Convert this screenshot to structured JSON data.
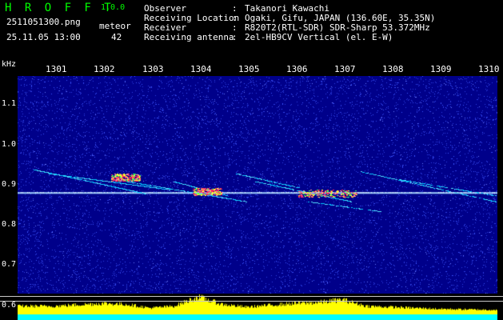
{
  "app": {
    "title": "H R O F F T",
    "version": "1.0.0"
  },
  "capture": {
    "filename": "2511051300.png",
    "datetime": "25.11.05 13:00",
    "meteor_label": "meteor",
    "meteor_count": "42"
  },
  "info": [
    {
      "label": "Observer",
      "sep": ":",
      "value": "Takanori Kawachi"
    },
    {
      "label": "Receiving Location",
      "sep": ":",
      "value": "Ogaki, Gifu, JAPAN (136.60E, 35.35N)"
    },
    {
      "label": "Receiver",
      "sep": ":",
      "value": "R820T2(RTL-SDR) SDR-Sharp 53.372MHz"
    },
    {
      "label": "Receiving antenna",
      "sep": ":",
      "value": "2el-HB9CV Vertical (el. E-W)"
    }
  ],
  "axes": {
    "y_unit": "kHz",
    "time_ticks": [
      "1301",
      "1302",
      "1303",
      "1304",
      "1305",
      "1306",
      "1307",
      "1308",
      "1309",
      "1310"
    ],
    "freq_ticks": [
      "1.1",
      "1.0",
      "0.9",
      "0.8",
      "0.7",
      "0.6"
    ]
  },
  "chart_data": {
    "type": "heatmap",
    "title": "",
    "xlabel": "",
    "ylabel": "kHz",
    "x_ticks": [
      "1301",
      "1302",
      "1303",
      "1304",
      "1305",
      "1306",
      "1307",
      "1308",
      "1309",
      "1310"
    ],
    "y_ticks": [
      1.1,
      1.0,
      0.9,
      0.8,
      0.7,
      0.6
    ],
    "ylim": [
      0.575,
      1.2
    ],
    "carrier_khz": 0.907,
    "colors": {
      "background": "#00008a",
      "noise": "#2f3fe0",
      "carrier": "#9fd0ff",
      "echo": "#00c8ff",
      "strong_echo": "#ff2060",
      "lower_signal": "#ffff00",
      "lower_base": "#00ffff"
    },
    "echoes_comment_free": true,
    "echoes": [
      {
        "t0": 1300.6,
        "f0": 0.965,
        "t1": 1302.9,
        "f1": 0.905,
        "intensity": 0.8
      },
      {
        "t0": 1300.9,
        "f0": 0.955,
        "t1": 1303.4,
        "f1": 0.915,
        "intensity": 0.7
      },
      {
        "t0": 1302.3,
        "f0": 0.94,
        "t1": 1305.0,
        "f1": 0.885,
        "intensity": 0.6
      },
      {
        "t0": 1304.8,
        "f0": 0.955,
        "t1": 1306.1,
        "f1": 0.92,
        "intensity": 0.6
      },
      {
        "t0": 1305.2,
        "f0": 0.935,
        "t1": 1307.2,
        "f1": 0.885,
        "intensity": 0.55
      },
      {
        "t0": 1307.4,
        "f0": 0.96,
        "t1": 1310.2,
        "f1": 0.885,
        "intensity": 0.5
      },
      {
        "t0": 1308.2,
        "f0": 0.94,
        "t1": 1310.2,
        "f1": 0.9,
        "intensity": 0.45
      },
      {
        "t0": 1303.5,
        "f0": 0.935,
        "t1": 1304.6,
        "f1": 0.9,
        "intensity": 0.45
      },
      {
        "t0": 1306.3,
        "f0": 0.885,
        "t1": 1307.8,
        "f1": 0.86,
        "intensity": 0.4
      }
    ],
    "hotspots": [
      {
        "t": 1302.5,
        "f": 0.945,
        "w": 0.6,
        "intensity": 1.0
      },
      {
        "t": 1304.2,
        "f": 0.91,
        "w": 0.6,
        "intensity": 1.0
      },
      {
        "t": 1306.7,
        "f": 0.905,
        "w": 1.2,
        "intensity": 0.9
      }
    ],
    "lower_level": [
      {
        "t": 1301.0,
        "v": 0.45
      },
      {
        "t": 1302.0,
        "v": 0.6
      },
      {
        "t": 1302.5,
        "v": 0.55
      },
      {
        "t": 1303.0,
        "v": 0.35
      },
      {
        "t": 1303.5,
        "v": 0.45
      },
      {
        "t": 1304.0,
        "v": 0.95
      },
      {
        "t": 1304.5,
        "v": 0.55
      },
      {
        "t": 1305.0,
        "v": 0.4
      },
      {
        "t": 1305.5,
        "v": 0.5
      },
      {
        "t": 1306.0,
        "v": 0.6
      },
      {
        "t": 1306.5,
        "v": 0.65
      },
      {
        "t": 1307.0,
        "v": 0.8
      },
      {
        "t": 1307.5,
        "v": 0.45
      },
      {
        "t": 1308.0,
        "v": 0.4
      },
      {
        "t": 1308.5,
        "v": 0.35
      },
      {
        "t": 1309.0,
        "v": 0.3
      },
      {
        "t": 1310.0,
        "v": 0.25
      }
    ]
  }
}
